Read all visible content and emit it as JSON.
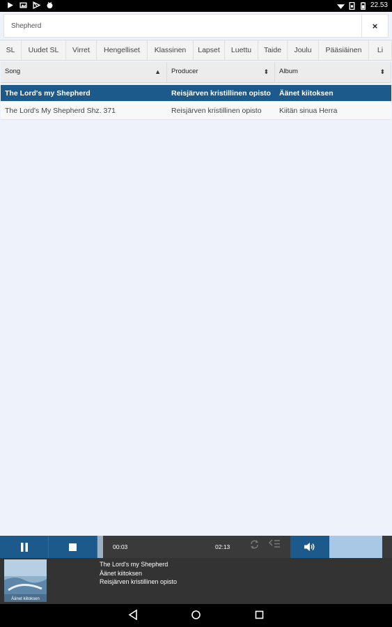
{
  "status_bar": {
    "time": "22.53",
    "left_icons": [
      "play-icon",
      "image-icon",
      "play-store-icon",
      "android-icon"
    ],
    "right_icons": [
      "wifi-icon",
      "sim-icon",
      "battery-icon"
    ]
  },
  "search": {
    "value": "Shepherd",
    "clear_label": "×"
  },
  "tabs": [
    "SL",
    "Uudet SL",
    "Virret",
    "Hengelliset",
    "Klassinen",
    "Lapset",
    "Luettu",
    "Taide",
    "Joulu",
    "Pääsiäinen",
    "Li"
  ],
  "table": {
    "headers": {
      "song": "Song",
      "producer": "Producer",
      "album": "Album"
    },
    "sort_icons": {
      "song": "▲",
      "producer": "⬍",
      "album": "⬍"
    },
    "rows": [
      {
        "song": "The Lord's my Shepherd",
        "producer": "Reisjärven kristillinen opisto",
        "album": "Äänet kiitoksen"
      },
      {
        "song": "The Lord's My Shepherd Shz. 371",
        "producer": "Reisjärven kristillinen opisto",
        "album": "Kiitän sinua Herra"
      }
    ]
  },
  "player": {
    "elapsed": "00:03",
    "duration": "02:13",
    "progress_fraction": 0.023,
    "icons": [
      "pause-icon",
      "stop-icon",
      "repeat-icon",
      "shuffle-icon",
      "volume-icon"
    ]
  },
  "now_playing": {
    "title": "The Lord's my Shepherd",
    "album": "Äänet kiitoksen",
    "producer": "Reisjärven kristillinen opisto",
    "cover_caption": "Äänet kiitoksen"
  },
  "colors": {
    "accent": "#1d5a8c",
    "background": "#eef3fb",
    "dark_bar": "#333333"
  }
}
